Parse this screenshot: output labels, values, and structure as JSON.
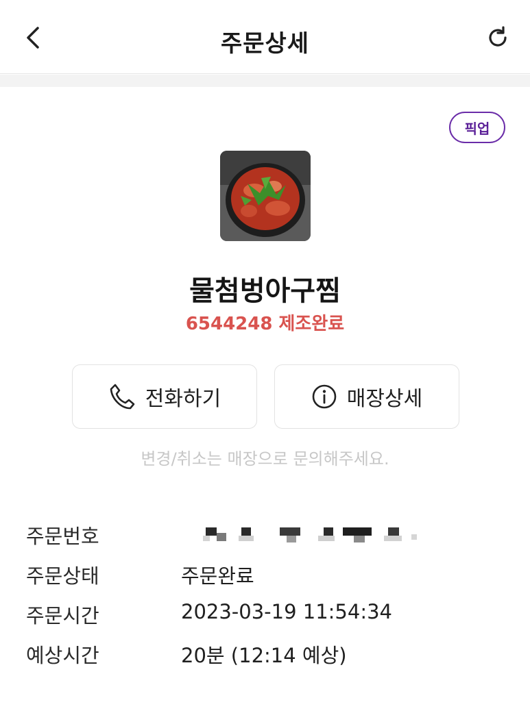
{
  "header": {
    "title": "주문상세",
    "back_icon": "chevron-left-icon",
    "refresh_icon": "refresh-icon"
  },
  "order": {
    "badge": "픽업",
    "store_name": "물첨벙아구찜",
    "status_line": "6544248 제조완료",
    "status_color": "#d9534f",
    "badge_color": "#5a1f97"
  },
  "actions": {
    "call_label": "전화하기",
    "store_detail_label": "매장상세",
    "call_icon": "phone-icon",
    "store_detail_icon": "info-icon"
  },
  "notice": "변경/취소는 매장으로 문의해주세요.",
  "details": [
    {
      "label": "주문번호",
      "value": ""
    },
    {
      "label": "주문상태",
      "value": "주문완료"
    },
    {
      "label": "주문시간",
      "value": "2023-03-19 11:54:34"
    },
    {
      "label": "예상시간",
      "value": "20분 (12:14 예상)"
    }
  ]
}
